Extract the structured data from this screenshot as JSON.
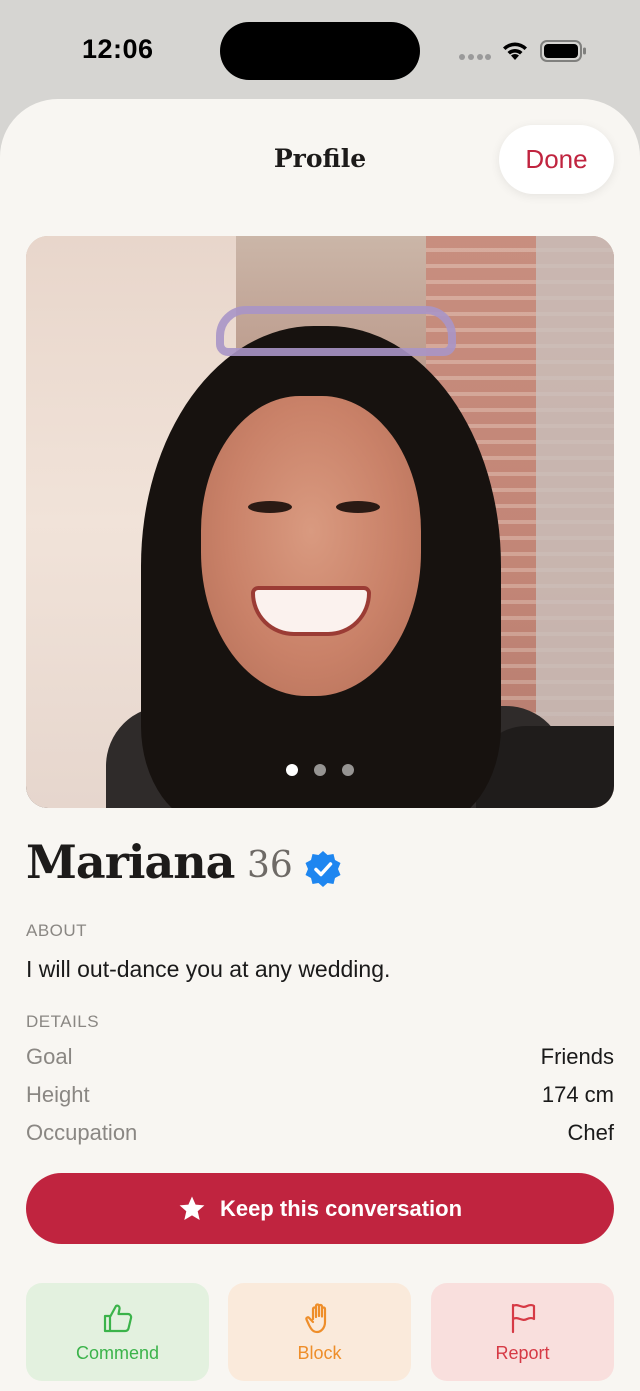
{
  "status_bar": {
    "time": "12:06"
  },
  "header": {
    "title": "Profile",
    "done_label": "Done"
  },
  "photo": {
    "page_count": 3,
    "active_page": 1
  },
  "profile": {
    "name": "Mariana",
    "age": "36",
    "verified": true,
    "about_label": "ABOUT",
    "about_text": "I will out-dance you at any wedding.",
    "details_label": "DETAILS",
    "details": [
      {
        "key": "Goal",
        "value": "Friends"
      },
      {
        "key": "Height",
        "value": "174 cm"
      },
      {
        "key": "Occupation",
        "value": "Chef"
      }
    ]
  },
  "primary_action": {
    "label": "Keep this conversation",
    "icon": "star-icon"
  },
  "actions": [
    {
      "label": "Commend",
      "icon": "thumbs-up-icon",
      "color": "#3bb34a"
    },
    {
      "label": "Block",
      "icon": "hand-icon",
      "color": "#ee8e2a"
    },
    {
      "label": "Report",
      "icon": "flag-icon",
      "color": "#d63a45"
    }
  ],
  "colors": {
    "accent": "#c0243f",
    "verified": "#1e86f0",
    "background": "#f8f6f2"
  }
}
